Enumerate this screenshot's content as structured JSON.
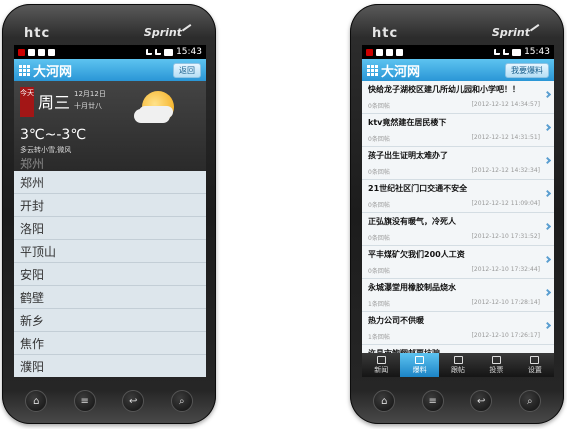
{
  "phones": {
    "brand": "htc",
    "carrier": "Sprint",
    "time": "15:43"
  },
  "left": {
    "app_title": "大河网",
    "top_button": "返回",
    "weather": {
      "today_tag": "今天",
      "weekday": "周三",
      "date": "12月12日",
      "lunar": "十月廿八",
      "temperature": "3℃~-3℃",
      "description": "多云转小雪,微风",
      "city": "郑州"
    },
    "cities": [
      "郑州",
      "开封",
      "洛阳",
      "平顶山",
      "安阳",
      "鹤壁",
      "新乡",
      "焦作",
      "濮阳"
    ]
  },
  "right": {
    "app_title": "大河网",
    "top_button": "我要爆料",
    "news": [
      {
        "title": "快给龙子湖校区建几所幼儿园和小学吧！！",
        "replies": "0条回帖",
        "time": "[2012-12-12 14:34:57]"
      },
      {
        "title": "ktv竟然建在居民楼下",
        "replies": "0条回帖",
        "time": "[2012-12-12 14:31:51]"
      },
      {
        "title": "孩子出生证明太难办了",
        "replies": "0条回帖",
        "time": "[2012-12-12 14:32:34]"
      },
      {
        "title": "21世纪社区门口交通不安全",
        "replies": "0条回帖",
        "time": "[2012-12-12 11:09:04]"
      },
      {
        "title": "正弘旗没有暖气，冷死人",
        "replies": "0条回帖",
        "time": "[2012-12-10 17:31:52]"
      },
      {
        "title": "平丰煤矿欠我们200人工资",
        "replies": "0条回帖",
        "time": "[2012-12-10 17:32:44]"
      },
      {
        "title": "永城瀑堂用橡胶制品烧水",
        "replies": "1条回帖",
        "time": "[2012-12-10 17:28:14]"
      },
      {
        "title": "热力公司不供暖",
        "replies": "1条回帖",
        "time": "[2012-12-10 17:26:17]"
      },
      {
        "title": "许昌市鲍翔邮票坑骗",
        "replies": "",
        "time": ""
      }
    ],
    "tabs": [
      "新闻",
      "爆料",
      "跟帖",
      "投票",
      "设置"
    ],
    "active_tab": "爆料"
  },
  "hardware_keys": [
    "home-icon",
    "menu-icon",
    "back-icon",
    "search-icon"
  ]
}
